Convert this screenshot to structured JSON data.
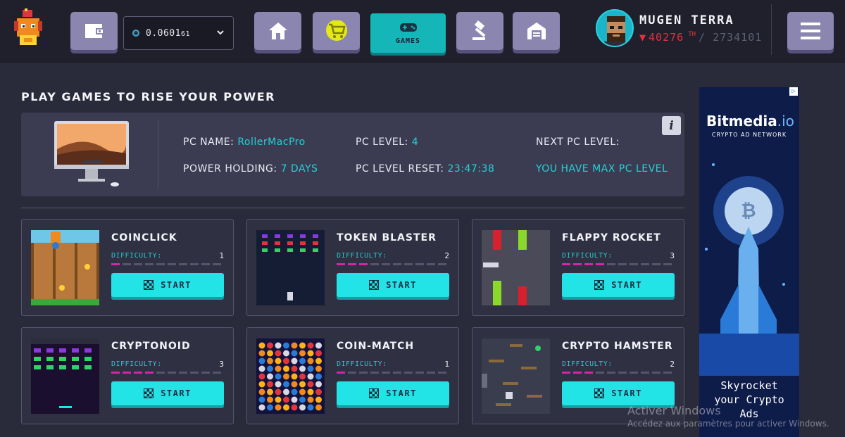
{
  "header": {
    "wallet_balance_main": "0.0601",
    "wallet_balance_small": "61",
    "games_label": "GAMES",
    "username": "MUGEN TERRA",
    "power_current": "40276",
    "power_unit": "TH",
    "power_total": "/ 2734101"
  },
  "main": {
    "title": "PLAY GAMES TO RISE YOUR POWER",
    "pc": {
      "name_label": "PC NAME:",
      "name_value": "RollerMacPro",
      "level_label": "PC LEVEL:",
      "level_value": "4",
      "next_level_label": "NEXT PC LEVEL:",
      "holding_label": "POWER HOLDING:",
      "holding_value": "7 DAYS",
      "reset_label": "PC LEVEL RESET:",
      "reset_value": "23:47:38",
      "max_level_text": "YOU HAVE MAX PC LEVEL",
      "info_label": "i"
    },
    "games": [
      {
        "name": "COINCLICK",
        "difficulty_label": "DIFFICULTY:",
        "difficulty": "1",
        "level": 1,
        "start_label": "START"
      },
      {
        "name": "TOKEN BLASTER",
        "difficulty_label": "DIFFICULTY:",
        "difficulty": "2",
        "level": 2,
        "start_label": "START"
      },
      {
        "name": "FLAPPY ROCKET",
        "difficulty_label": "DIFFICULTY:",
        "difficulty": "3",
        "level": 3,
        "start_label": "START"
      },
      {
        "name": "CRYPTONOID",
        "difficulty_label": "DIFFICULTY:",
        "difficulty": "3",
        "level": 3,
        "start_label": "START"
      },
      {
        "name": "COIN-MATCH",
        "difficulty_label": "DIFFICULTY:",
        "difficulty": "1",
        "level": 1,
        "start_label": "START"
      },
      {
        "name": "CRYPTO HAMSTER",
        "difficulty_label": "DIFFICULTY:",
        "difficulty": "2",
        "level": 2,
        "start_label": "START"
      }
    ]
  },
  "ad": {
    "badge": "▷",
    "brand": "Bitmedia",
    "brand_suffix": ".io",
    "tagline": "CRYPTO AD NETWORK",
    "footer_line1": "Skyrocket",
    "footer_line2": "your Crypto",
    "footer_line3": "Ads"
  },
  "watermark": {
    "line1": "Activer Windows",
    "line2": "Accédez aux paramètres pour activer Windows."
  },
  "colors": {
    "accent": "#22e3e6",
    "nav_button": "#8b86b0",
    "power_down": "#e0343f",
    "difficulty_on": "#d326a8",
    "background": "#2a2b3a"
  },
  "icons": [
    "wallet-icon",
    "home-icon",
    "cart-icon",
    "gamepad-icon",
    "auction-icon",
    "garage-icon",
    "menu-icon",
    "chevron-down-icon",
    "info-icon",
    "flag-icon",
    "bitcoin-icon",
    "rocket-icon"
  ]
}
